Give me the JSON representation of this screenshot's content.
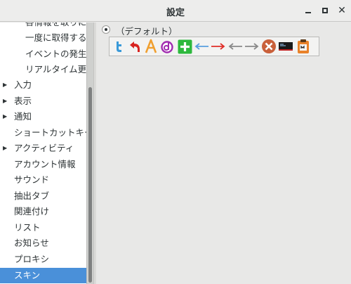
{
  "window": {
    "title": "設定"
  },
  "sidebar": {
    "items": [
      {
        "label": "各情報を取りに行",
        "indent": 2,
        "expander": false
      },
      {
        "label": "一度に取得する",
        "indent": 2,
        "expander": false
      },
      {
        "label": "イベントの発生頻",
        "indent": 2,
        "expander": false
      },
      {
        "label": "リアルタイム更新",
        "indent": 2,
        "expander": false
      },
      {
        "label": "入力",
        "indent": 1,
        "expander": true
      },
      {
        "label": "表示",
        "indent": 1,
        "expander": true
      },
      {
        "label": "通知",
        "indent": 1,
        "expander": true
      },
      {
        "label": "ショートカットキー",
        "indent": 1,
        "expander": false
      },
      {
        "label": "アクティビティ",
        "indent": 1,
        "expander": true
      },
      {
        "label": "アカウント情報",
        "indent": 1,
        "expander": false
      },
      {
        "label": "サウンド",
        "indent": 1,
        "expander": false
      },
      {
        "label": "抽出タブ",
        "indent": 1,
        "expander": false
      },
      {
        "label": "関連付け",
        "indent": 1,
        "expander": false
      },
      {
        "label": "リスト",
        "indent": 1,
        "expander": false
      },
      {
        "label": "お知らせ",
        "indent": 1,
        "expander": false
      },
      {
        "label": "プロキシ",
        "indent": 1,
        "expander": false
      },
      {
        "label": "スキン",
        "indent": 1,
        "expander": false,
        "selected": true
      }
    ]
  },
  "skin": {
    "option_label": "（デフォルト）",
    "selected": true,
    "preview_icons": [
      "twitter-icon",
      "undo-arrow-icon",
      "font-a-icon",
      "d-letter-icon",
      "add-plus-icon",
      "arrow-left-blue-icon",
      "arrow-right-red-icon",
      "arrow-left-gray-icon",
      "arrow-right-gray-icon",
      "close-x-circle-icon",
      "terminal-icon",
      "clipboard-icon"
    ]
  },
  "colors": {
    "selection": "#4a90d9",
    "content_bg": "#e8e8e7",
    "sidebar_bg": "#ffffff"
  }
}
